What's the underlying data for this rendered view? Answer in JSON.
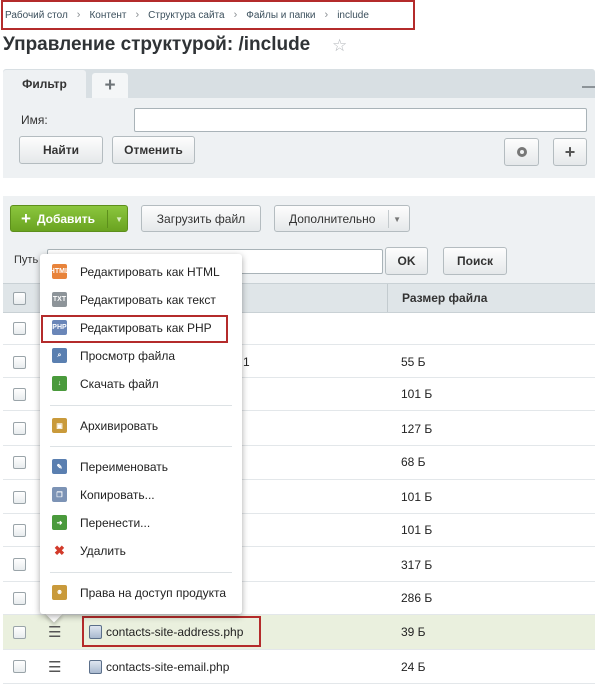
{
  "breadcrumb": [
    "Рабочий стол",
    "Контент",
    "Структура сайта",
    "Файлы и папки",
    "include"
  ],
  "page_title": "Управление структурой: /include",
  "filter": {
    "tab_label": "Фильтр",
    "name_label": "Имя:",
    "name_value": "",
    "find_label": "Найти",
    "cancel_label": "Отменить"
  },
  "toolbar": {
    "add_label": "Добавить",
    "upload_label": "Загрузить файл",
    "more_label": "Дополнительно"
  },
  "path": {
    "label": "Путь",
    "value": "",
    "ok_label": "OK",
    "search_label": "Поиск"
  },
  "grid": {
    "size_header": "Размер файла",
    "rows": [
      {
        "name": "",
        "size": "",
        "fragment": ""
      },
      {
        "name": "",
        "size": "55 Б",
        "fragment": "1"
      },
      {
        "name": "",
        "size": "101 Б",
        "fragment": ""
      },
      {
        "name": "",
        "size": "127 Б",
        "fragment": ""
      },
      {
        "name": "",
        "size": "68 Б",
        "fragment": ""
      },
      {
        "name": "",
        "size": "101 Б",
        "fragment": ""
      },
      {
        "name": "",
        "size": "101 Б",
        "fragment": ""
      },
      {
        "name": "",
        "size": "317 Б",
        "fragment": ""
      },
      {
        "name": "",
        "size": "286 Б",
        "fragment": ""
      },
      {
        "name": "contacts-site-address.php",
        "size": "39 Б",
        "fragment": ""
      },
      {
        "name": "contacts-site-email.php",
        "size": "24 Б",
        "fragment": ""
      }
    ]
  },
  "context_menu": {
    "items": [
      {
        "label": "Редактировать как HTML",
        "icon": "edit-html-icon",
        "color": "#e8833a",
        "tag": "HTML"
      },
      {
        "label": "Редактировать как текст",
        "icon": "edit-text-icon",
        "color": "#8d9499",
        "tag": "TXT"
      },
      {
        "label": "Редактировать как PHP",
        "icon": "edit-php-icon",
        "color": "#6a86b8",
        "tag": "PHP"
      },
      {
        "label": "Просмотр файла",
        "icon": "view-file-icon",
        "color": "#5a7fb0",
        "tag": ""
      },
      {
        "label": "Скачать файл",
        "icon": "download-file-icon",
        "color": "#4a9a3c",
        "tag": ""
      },
      {
        "label": "Архивировать",
        "icon": "archive-icon",
        "color": "#c99a3b",
        "tag": ""
      },
      {
        "label": "Переименовать",
        "icon": "rename-icon",
        "color": "#5a7fb0",
        "tag": ""
      },
      {
        "label": "Копировать...",
        "icon": "copy-icon",
        "color": "#7c93b5",
        "tag": ""
      },
      {
        "label": "Перенести...",
        "icon": "move-icon",
        "color": "#4a9a3c",
        "tag": ""
      },
      {
        "label": "Удалить",
        "icon": "delete-icon",
        "color": "#d23a2a",
        "tag": ""
      },
      {
        "label": "Права на доступ продукта",
        "icon": "access-rights-icon",
        "color": "#c99a3b",
        "tag": ""
      }
    ]
  },
  "colors": {
    "highlight": "#b42b2b",
    "add_button": "#6aa320",
    "selected_row": "#eaf0de"
  }
}
